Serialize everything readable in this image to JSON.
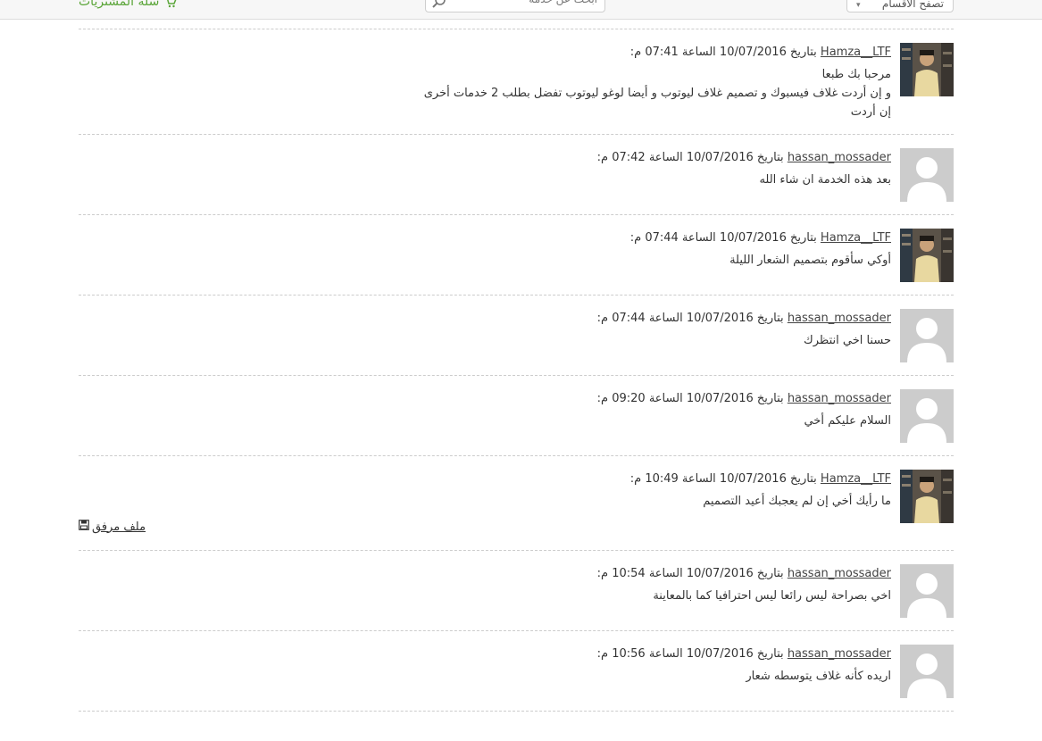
{
  "header": {
    "cart_label": "سلة المشتريات",
    "cart_icon": "cart-icon",
    "search_placeholder": "ابحث عن خدمة",
    "search_icon": "search-icon",
    "categories_label": "تصفح الأقسام",
    "accent_color": "#5aa538"
  },
  "messages": [
    {
      "author": "Hamza__LTF",
      "avatar": "photo",
      "meta": "بتاريخ 10/07/2016 الساعة 07:41 م:",
      "lines": [
        "مرحبا بك طبعا",
        "و إن أردت غلاف فيسبوك و تصميم غلاف ليوتوب و أيضا لوغو ليوتوب تفضل بطلب 2 خدمات أخرى",
        "إن أردت"
      ]
    },
    {
      "author": "hassan_mossader",
      "avatar": "default",
      "meta": "بتاريخ 10/07/2016 الساعة 07:42 م:",
      "lines": [
        "بعد هذه الخدمة ان شاء الله"
      ]
    },
    {
      "author": "Hamza__LTF",
      "avatar": "photo",
      "meta": "بتاريخ 10/07/2016 الساعة 07:44 م:",
      "lines": [
        "أوكي سأقوم بتصميم الشعار الليلة"
      ]
    },
    {
      "author": "hassan_mossader",
      "avatar": "default",
      "meta": "بتاريخ 10/07/2016 الساعة 07:44 م:",
      "lines": [
        "حسنا اخي انتظرك"
      ]
    },
    {
      "author": "hassan_mossader",
      "avatar": "default",
      "meta": "بتاريخ 10/07/2016 الساعة 09:20 م:",
      "lines": [
        "السلام عليكم أخي"
      ]
    },
    {
      "author": "Hamza__LTF",
      "avatar": "photo",
      "meta": "بتاريخ 10/07/2016 الساعة 10:49 م:",
      "lines": [
        "ما رأيك أخي إن لم يعجبك أعيد التصميم"
      ],
      "attachment": "ملف مرفق"
    },
    {
      "author": "hassan_mossader",
      "avatar": "default",
      "meta": "بتاريخ 10/07/2016 الساعة 10:54 م:",
      "lines": [
        "اخي بصراحة ليس رائعا ليس احترافيا كما بالمعاينة"
      ]
    },
    {
      "author": "hassan_mossader",
      "avatar": "default",
      "meta": "بتاريخ 10/07/2016 الساعة 10:56 م:",
      "lines": [
        "اريده كأنه غلاف يتوسطه شعار"
      ]
    }
  ]
}
